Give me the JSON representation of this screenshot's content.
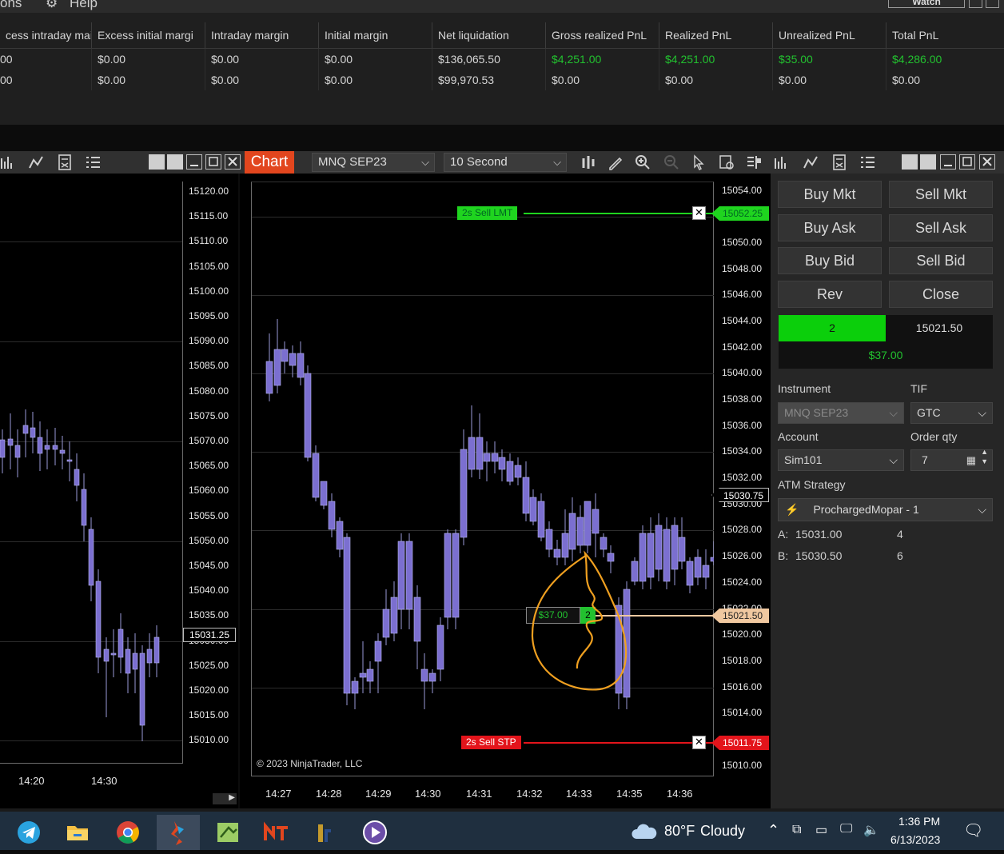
{
  "menubar": {
    "item1": "ons",
    "item2": "Help",
    "watch_label": "Watch"
  },
  "accounts": {
    "headers": [
      "cess intraday mai",
      "Excess initial margi",
      "Intraday margin",
      "Initial margin",
      "Net liquidation",
      "Gross realized PnL",
      "Realized PnL",
      "Unrealized PnL",
      "Total PnL"
    ],
    "rows": [
      [
        "00",
        "$0.00",
        "$0.00",
        "$0.00",
        "$136,065.50",
        "$4,251.00",
        "$4,251.00",
        "$35.00",
        "$4,286.00"
      ],
      [
        "00",
        "$0.00",
        "$0.00",
        "$0.00",
        "$99,970.53",
        "$0.00",
        "$0.00",
        "$0.00",
        "$0.00"
      ]
    ],
    "green_color": "#22c12f"
  },
  "toolbar": {
    "chart_tab": "Chart",
    "instrument": "MNQ SEP23",
    "interval": "10 Second"
  },
  "left_chart": {
    "y_ticks": [
      "15120.00",
      "15115.00",
      "15110.00",
      "15105.00",
      "15100.00",
      "15095.00",
      "15090.00",
      "15085.00",
      "15080.00",
      "15075.00",
      "15070.00",
      "15065.00",
      "15060.00",
      "15055.00",
      "15050.00",
      "15045.00",
      "15040.00",
      "15035.00",
      "15030.00",
      "15025.00",
      "15020.00",
      "15015.00",
      "15010.00"
    ],
    "last_price": "15031.25",
    "x_ticks": [
      "14:20",
      "14:30"
    ]
  },
  "right_chart": {
    "y_ticks": [
      "15054.00",
      "15050.00",
      "15048.00",
      "15046.00",
      "15044.00",
      "15042.00",
      "15040.00",
      "15038.00",
      "15036.00",
      "15034.00",
      "15032.00",
      "15030.00",
      "15028.00",
      "15026.00",
      "15024.00",
      "15022.00",
      "15020.00",
      "15018.00",
      "15016.00",
      "15014.00",
      "15010.00"
    ],
    "x_ticks": [
      "14:27",
      "14:28",
      "14:29",
      "14:30",
      "14:31",
      "14:32",
      "14:33",
      "14:35",
      "14:36"
    ],
    "copyright": "© 2023 NinjaTrader, LLC",
    "limit_order": {
      "label": "2s  Sell LMT",
      "price": "15052.25",
      "color": "#1fd41f"
    },
    "stop_order": {
      "label": "2s  Sell STP",
      "price": "15011.75",
      "color": "#e3141b"
    },
    "position": {
      "pnl": "$37.00",
      "qty": "2",
      "price": "15021.50",
      "color": "#f0c8a0"
    },
    "last_price": "15030.75",
    "candle_color": "#7b6fd0",
    "annotation_color": "#f0a020"
  },
  "trader": {
    "buttons": {
      "buy_mkt": "Buy Mkt",
      "sell_mkt": "Sell Mkt",
      "buy_ask": "Buy Ask",
      "sell_ask": "Sell Ask",
      "buy_bid": "Buy Bid",
      "sell_bid": "Sell Bid",
      "rev": "Rev",
      "close": "Close"
    },
    "position_qty": "2",
    "position_price": "15021.50",
    "position_pnl": "$37.00",
    "instrument_label": "Instrument",
    "instrument_value": "MNQ SEP23",
    "tif_label": "TIF",
    "tif_value": "GTC",
    "account_label": "Account",
    "account_value": "Sim101",
    "order_qty_label": "Order qty",
    "order_qty_value": "7",
    "atm_label": "ATM Strategy",
    "atm_value": "ProchargedMopar - 1",
    "ask_label": "A:",
    "ask_price": "15031.00",
    "ask_size": "4",
    "bid_label": "B:",
    "bid_price": "15030.50",
    "bid_size": "6"
  },
  "taskbar": {
    "weather_temp": "80°F",
    "weather_desc": "Cloudy",
    "time": "1:36 PM",
    "date": "6/13/2023",
    "apps": [
      "telegram-icon",
      "file-explorer-icon",
      "chrome-icon",
      "ninjatrader-icon",
      "app-green-icon",
      "nt-icon",
      "tradingview-icon",
      "media-player-icon"
    ]
  }
}
